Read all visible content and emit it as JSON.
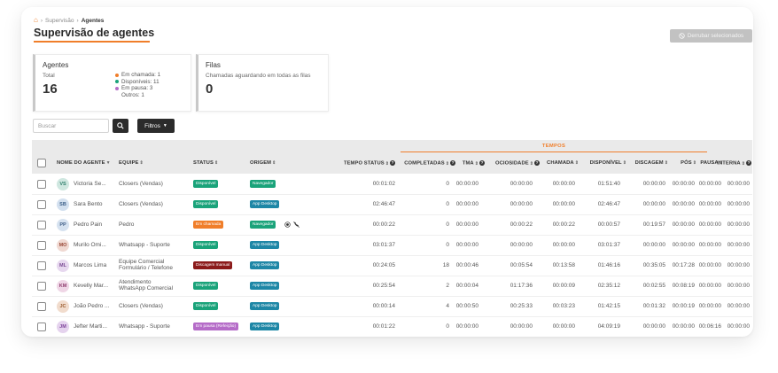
{
  "breadcrumb": {
    "root": "Supervisão",
    "current": "Agentes"
  },
  "page_title": "Supervisão de agentes",
  "drop_selected_label": "Derrubar selecionados",
  "agents_card": {
    "title": "Agentes",
    "total_label": "Total",
    "total_value": "16",
    "legend": [
      {
        "label": "Em chamada: 1",
        "color": "#f07e2a"
      },
      {
        "label": "Disponíveis: 11",
        "color": "#1aa37a"
      },
      {
        "label": "Em pausa: 3",
        "color": "#b56cc8"
      },
      {
        "label": "Outros: 1",
        "color": ""
      }
    ]
  },
  "queues_card": {
    "title": "Filas",
    "subtitle": "Chamadas aguardando em todas as filas",
    "value": "0"
  },
  "search": {
    "placeholder": "Buscar",
    "value": ""
  },
  "filter_label": "Filtros",
  "table": {
    "group_label": "TEMPOS",
    "columns": {
      "agent": "NOME DO AGENTE",
      "team": "EQUIPE",
      "status": "STATUS",
      "origin": "ORIGEM",
      "status_time": "TEMPO STATUS",
      "completed": "COMPLETADAS",
      "tma": "TMA",
      "idle": "OCIOSIDADE",
      "calling": "CHAMADA",
      "available": "DISPONÍVEL",
      "dialing": "DISCAGEM",
      "post": "PÓS",
      "pause": "PAUSA",
      "internal": "INTERNA"
    },
    "rows": [
      {
        "initials": "VS",
        "avatar_bg": "#cfe7e0",
        "avatar_fg": "#2f7f6c",
        "name": "Victoria Se...",
        "team": "Closers (Vendas)",
        "team2": "",
        "status": "Disponível",
        "status_color": "#1aa37a",
        "origin": "Navegador",
        "origin_color": "#1aa37a",
        "status_time": "00:01:02",
        "completed": "0",
        "tma": "00:00:00",
        "idle": "00:00:00",
        "calling": "00:00:00",
        "available": "01:51:40",
        "dialing": "00:00:00",
        "post": "00:00:00",
        "pause": "00:00:00",
        "internal": "00:00:00"
      },
      {
        "initials": "SB",
        "avatar_bg": "#d3e0ef",
        "avatar_fg": "#3c5f88",
        "name": "Sara Bento",
        "team": "Closers (Vendas)",
        "team2": "",
        "status": "Disponível",
        "status_color": "#1aa37a",
        "origin": "App Desktop",
        "origin_color": "#1e87a6",
        "status_time": "02:46:47",
        "completed": "0",
        "tma": "00:00:00",
        "idle": "00:00:00",
        "calling": "00:00:00",
        "available": "02:46:47",
        "dialing": "00:00:00",
        "post": "00:00:00",
        "pause": "00:00:00",
        "internal": "00:00:00"
      },
      {
        "initials": "PP",
        "avatar_bg": "#d6e2f0",
        "avatar_fg": "#44628a",
        "name": "Pedro Pain",
        "team": "Pedro",
        "team2": "",
        "status": "Em chamada",
        "status_color": "#f07e2a",
        "origin": "Navegador",
        "origin_color": "#1aa37a",
        "status_time": "00:00:22",
        "completed": "0",
        "tma": "00:00:00",
        "idle": "00:00:22",
        "calling": "00:00:22",
        "available": "00:00:57",
        "dialing": "00:19:57",
        "post": "00:00:00",
        "pause": "00:00:00",
        "internal": "00:00:00"
      },
      {
        "initials": "MO",
        "avatar_bg": "#f0d9d2",
        "avatar_fg": "#9a4a38",
        "name": "Murilo Omi...",
        "team": "Whatsapp - Suporte",
        "team2": "",
        "status": "Disponível",
        "status_color": "#1aa37a",
        "origin": "App Desktop",
        "origin_color": "#1e87a6",
        "status_time": "03:01:37",
        "completed": "0",
        "tma": "00:00:00",
        "idle": "00:00:00",
        "calling": "00:00:00",
        "available": "03:01:37",
        "dialing": "00:00:00",
        "post": "00:00:00",
        "pause": "00:00:00",
        "internal": "00:00:00"
      },
      {
        "initials": "ML",
        "avatar_bg": "#e7d8ef",
        "avatar_fg": "#7a4a94",
        "name": "Marcos Lima",
        "team": "Equipe Comercial",
        "team2": "Formulário / Telefone",
        "status": "Discagem manual",
        "status_color": "#8b1a1a",
        "origin": "App Desktop",
        "origin_color": "#1e87a6",
        "status_time": "00:24:05",
        "completed": "18",
        "tma": "00:00:46",
        "idle": "00:05:54",
        "calling": "00:13:58",
        "available": "01:46:16",
        "dialing": "00:35:05",
        "post": "00:17:28",
        "pause": "00:00:00",
        "internal": "00:00:00"
      },
      {
        "initials": "KM",
        "avatar_bg": "#efd6e6",
        "avatar_fg": "#8e3c6e",
        "name": "Kevelly Mar...",
        "team": "Atendimento",
        "team2": "WhatsApp Comercial",
        "status": "Disponível",
        "status_color": "#1aa37a",
        "origin": "App Desktop",
        "origin_color": "#1e87a6",
        "status_time": "00:25:54",
        "completed": "2",
        "tma": "00:00:04",
        "idle": "01:17:36",
        "calling": "00:00:09",
        "available": "02:35:12",
        "dialing": "00:02:55",
        "post": "00:08:19",
        "pause": "00:00:00",
        "internal": "00:00:00"
      },
      {
        "initials": "JC",
        "avatar_bg": "#f1dccd",
        "avatar_fg": "#9a5a2c",
        "name": "João Pedro ...",
        "team": "Closers (Vendas)",
        "team2": "",
        "status": "Disponível",
        "status_color": "#1aa37a",
        "origin": "App Desktop",
        "origin_color": "#1e87a6",
        "status_time": "00:00:14",
        "completed": "4",
        "tma": "00:00:50",
        "idle": "00:25:33",
        "calling": "00:03:23",
        "available": "01:42:15",
        "dialing": "00:01:32",
        "post": "00:00:19",
        "pause": "00:00:00",
        "internal": "00:00:00"
      },
      {
        "initials": "JM",
        "avatar_bg": "#e5d3ee",
        "avatar_fg": "#7a3f98",
        "name": "Jefter Marti...",
        "team": "Whatsapp - Suporte",
        "team2": "",
        "status": "Em pausa (Refeição)",
        "status_color": "#b56cc8",
        "origin": "App Desktop",
        "origin_color": "#1e87a6",
        "status_time": "00:01:22",
        "completed": "0",
        "tma": "00:00:00",
        "idle": "00:00:00",
        "calling": "00:00:00",
        "available": "04:09:19",
        "dialing": "00:00:00",
        "post": "00:00:00",
        "pause": "00:06:16",
        "internal": "00:00:00"
      }
    ]
  }
}
